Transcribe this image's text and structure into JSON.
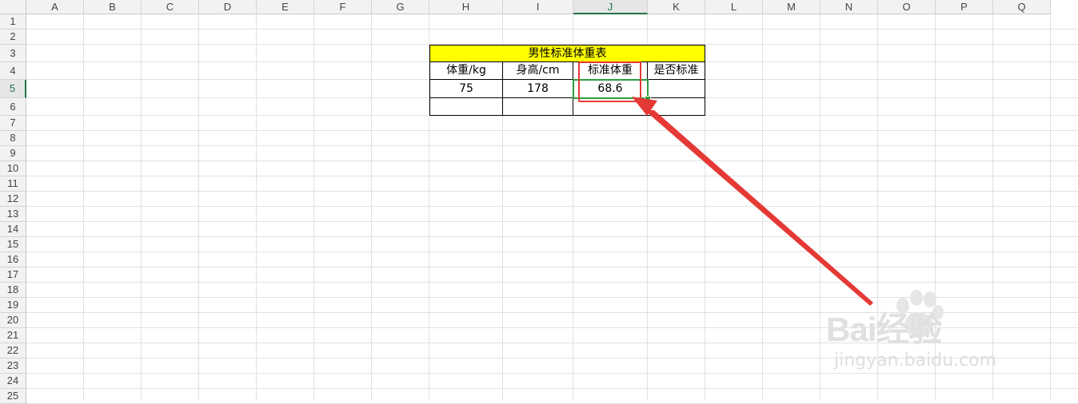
{
  "columns": [
    "A",
    "B",
    "C",
    "D",
    "E",
    "F",
    "G",
    "H",
    "I",
    "J",
    "K",
    "L",
    "M",
    "N",
    "O",
    "P",
    "Q"
  ],
  "active_column": "J",
  "rows": [
    "1",
    "2",
    "3",
    "4",
    "5",
    "6",
    "7",
    "8",
    "9",
    "10",
    "11",
    "12",
    "13",
    "14",
    "15",
    "16",
    "17",
    "18",
    "19",
    "20",
    "21",
    "22",
    "23",
    "24",
    "25"
  ],
  "active_row": "5",
  "table": {
    "title": "男性标准体重表",
    "headers": [
      "体重/kg",
      "身高/cm",
      "标准体重",
      "是否标准"
    ],
    "values": [
      "75",
      "178",
      "68.6",
      ""
    ],
    "blank_row": [
      "",
      "",
      "",
      ""
    ]
  },
  "selected_cell": "J5",
  "annotation": {
    "box_color": "#e53935",
    "arrow_color": "#e53935"
  },
  "watermark": {
    "brand": "Bai经验",
    "sub": "jingyan.baidu.com"
  },
  "colors": {
    "title_fill": "#ffff00",
    "selection": "#2e9b3e",
    "accent": "#217346"
  }
}
